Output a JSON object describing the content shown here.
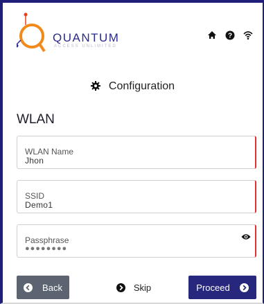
{
  "brand": {
    "name": "QUANTUM",
    "tagline": "ACCESS UNLIMITED",
    "colors": {
      "navy": "#27277e",
      "orange": "#e8401c",
      "blue": "#2a2a8a",
      "accent": "#e0322e"
    }
  },
  "header_icons": [
    "home-icon",
    "help-icon",
    "wifi-icon"
  ],
  "section": {
    "title": "Configuration",
    "icon": "gear-icon"
  },
  "wlan": {
    "heading": "WLAN",
    "fields": [
      {
        "label": "WLAN Name",
        "value": "Jhon"
      },
      {
        "label": "SSID",
        "value": "Demo1"
      },
      {
        "label": "Passphrase",
        "value": "●●●●●●●●",
        "masked": true,
        "toggle_icon": "eye-icon"
      }
    ]
  },
  "actions": {
    "back": "Back",
    "skip": "Skip",
    "proceed": "Proceed"
  }
}
